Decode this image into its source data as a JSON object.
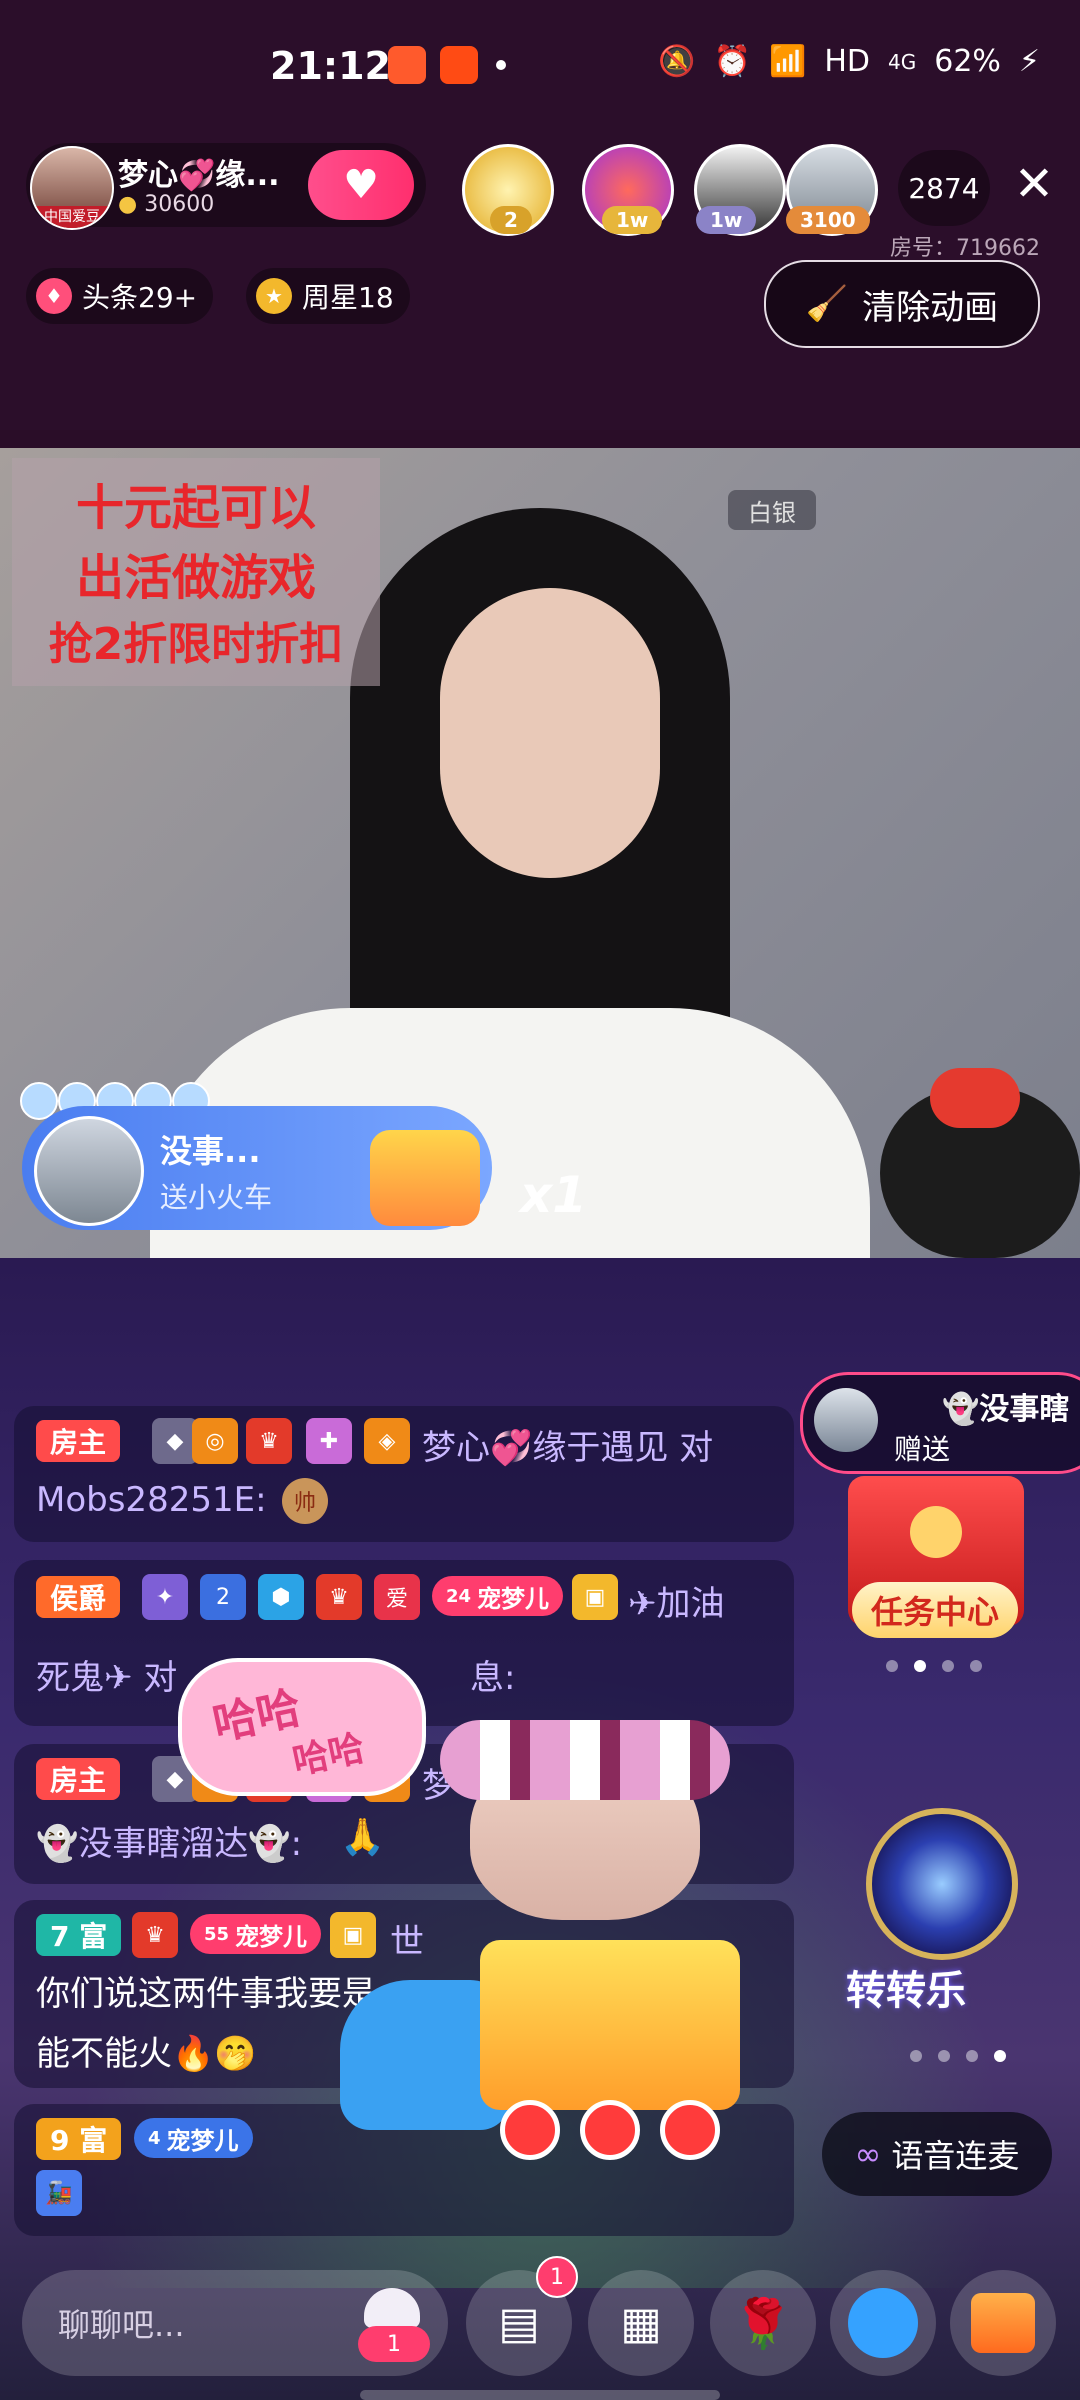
{
  "status_bar": {
    "time": "21:12",
    "network": "HD",
    "signal": "4G",
    "battery": "62%"
  },
  "host": {
    "name": "梦心💞缘...",
    "fans": "30600",
    "avatar_tag": "中国爱豆"
  },
  "viewers": [
    {
      "badge": "2"
    },
    {
      "badge": "1w"
    },
    {
      "badge": "1w"
    },
    {
      "badge": "3100"
    }
  ],
  "viewer_count": "2874",
  "room_number": "房号：719662",
  "pills": {
    "headline": "头条29+",
    "weekly_star": "周星18"
  },
  "clear_animation_label": "清除动画",
  "video": {
    "promo_lines": [
      "十元起可以",
      "出活做游戏",
      "抢2折限时折扣"
    ],
    "rank_badge": "白银"
  },
  "gift_banner": {
    "sender": "没事...",
    "action": "送小火车",
    "count": "x1"
  },
  "chat": [
    {
      "tag": "房主",
      "tag_color": "#ff4b4b",
      "text_line1": "梦心💞缘于遇见 对",
      "text_line2": "Mobs28251E:",
      "emoji": "帅"
    },
    {
      "tag": "侯爵",
      "tag_color": "#ff6a2a",
      "level": "2",
      "love_tag": "爱",
      "pet_level": "24",
      "pet_name": "宠梦儿",
      "text_line1": "✈加油",
      "text_line2": "死鬼✈ 对",
      "text_tail": "息:"
    },
    {
      "tag": "房主",
      "tag_color": "#ff4b4b",
      "text_line1": "梦",
      "text_line2": "👻没事瞎溜达👻:",
      "emoji": "🙏"
    },
    {
      "tag": "7 富",
      "tag_color": "#1fb7a6",
      "pet_level": "55",
      "pet_name": "宠梦儿",
      "text_line1": "世",
      "text_line2": "你们说这两件事我要是",
      "text_line3": "能不能火🔥🤭"
    },
    {
      "tag": "9 富",
      "tag_color": "#f3a21c",
      "pet_level": "4",
      "pet_name": "宠梦儿"
    }
  ],
  "side_gift": {
    "sender": "👻没事瞎",
    "action": "赠送"
  },
  "task_center_label": "任务中心",
  "zhuanzhuanle_label": "转转乐",
  "ha_bubble": {
    "line1": "哈哈",
    "line2": "哈哈"
  },
  "voice_link_label": "语音连麦",
  "chat_input_placeholder": "聊聊吧...",
  "badges": {
    "messages": "1",
    "pin": "1"
  },
  "colors": {
    "background": "#2b0e2a",
    "accent": "#ff2f6e",
    "lower_bg": "#3a2a6e"
  }
}
